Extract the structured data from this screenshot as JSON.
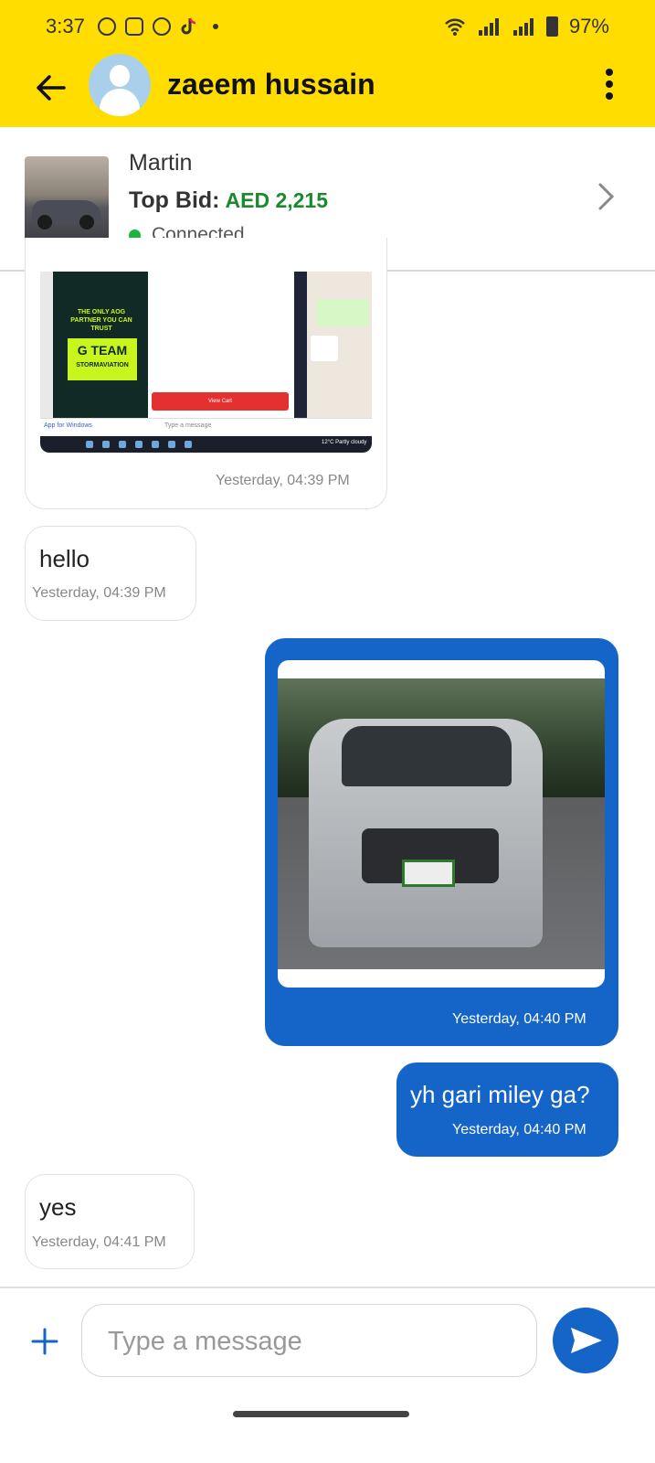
{
  "status_bar": {
    "time": "3:37",
    "battery": "97%",
    "notification_icons": [
      "facebook-icon",
      "instagram-icon",
      "messenger-icon",
      "tiktok-icon"
    ]
  },
  "header": {
    "contact_name": "zaeem hussain"
  },
  "listing": {
    "seller": "Martin",
    "top_bid_label": "Top Bid:",
    "top_bid_amount": "AED 2,215",
    "status": "Connected"
  },
  "shot_texts": {
    "ad_line": "THE ONLY AOG PARTNER YOU CAN TRUST",
    "ad_brand": "G TEAM",
    "ad_sub": "STORMAVIATION",
    "view_cart": "View Cart",
    "type_msg": "Type a message",
    "app_windows": "App for Windows",
    "weather": "12°C  Partly cloudy"
  },
  "messages": [
    {
      "direction": "incoming",
      "type": "image",
      "time": "Yesterday, 04:39 PM"
    },
    {
      "direction": "incoming",
      "type": "text",
      "text": "hello",
      "time": "Yesterday, 04:39 PM"
    },
    {
      "direction": "outgoing",
      "type": "image",
      "time": "Yesterday, 04:40 PM"
    },
    {
      "direction": "outgoing",
      "type": "text",
      "text": "yh gari miley ga?",
      "time": "Yesterday, 04:40 PM"
    },
    {
      "direction": "incoming",
      "type": "text",
      "text": "yes",
      "time": "Yesterday, 04:41 PM"
    }
  ],
  "composer": {
    "placeholder": "Type a message"
  },
  "colors": {
    "brand_yellow": "#FFDD00",
    "outgoing_bubble": "#1565C8",
    "bid_green": "#1B8A2E",
    "online_green": "#1DB53B"
  }
}
